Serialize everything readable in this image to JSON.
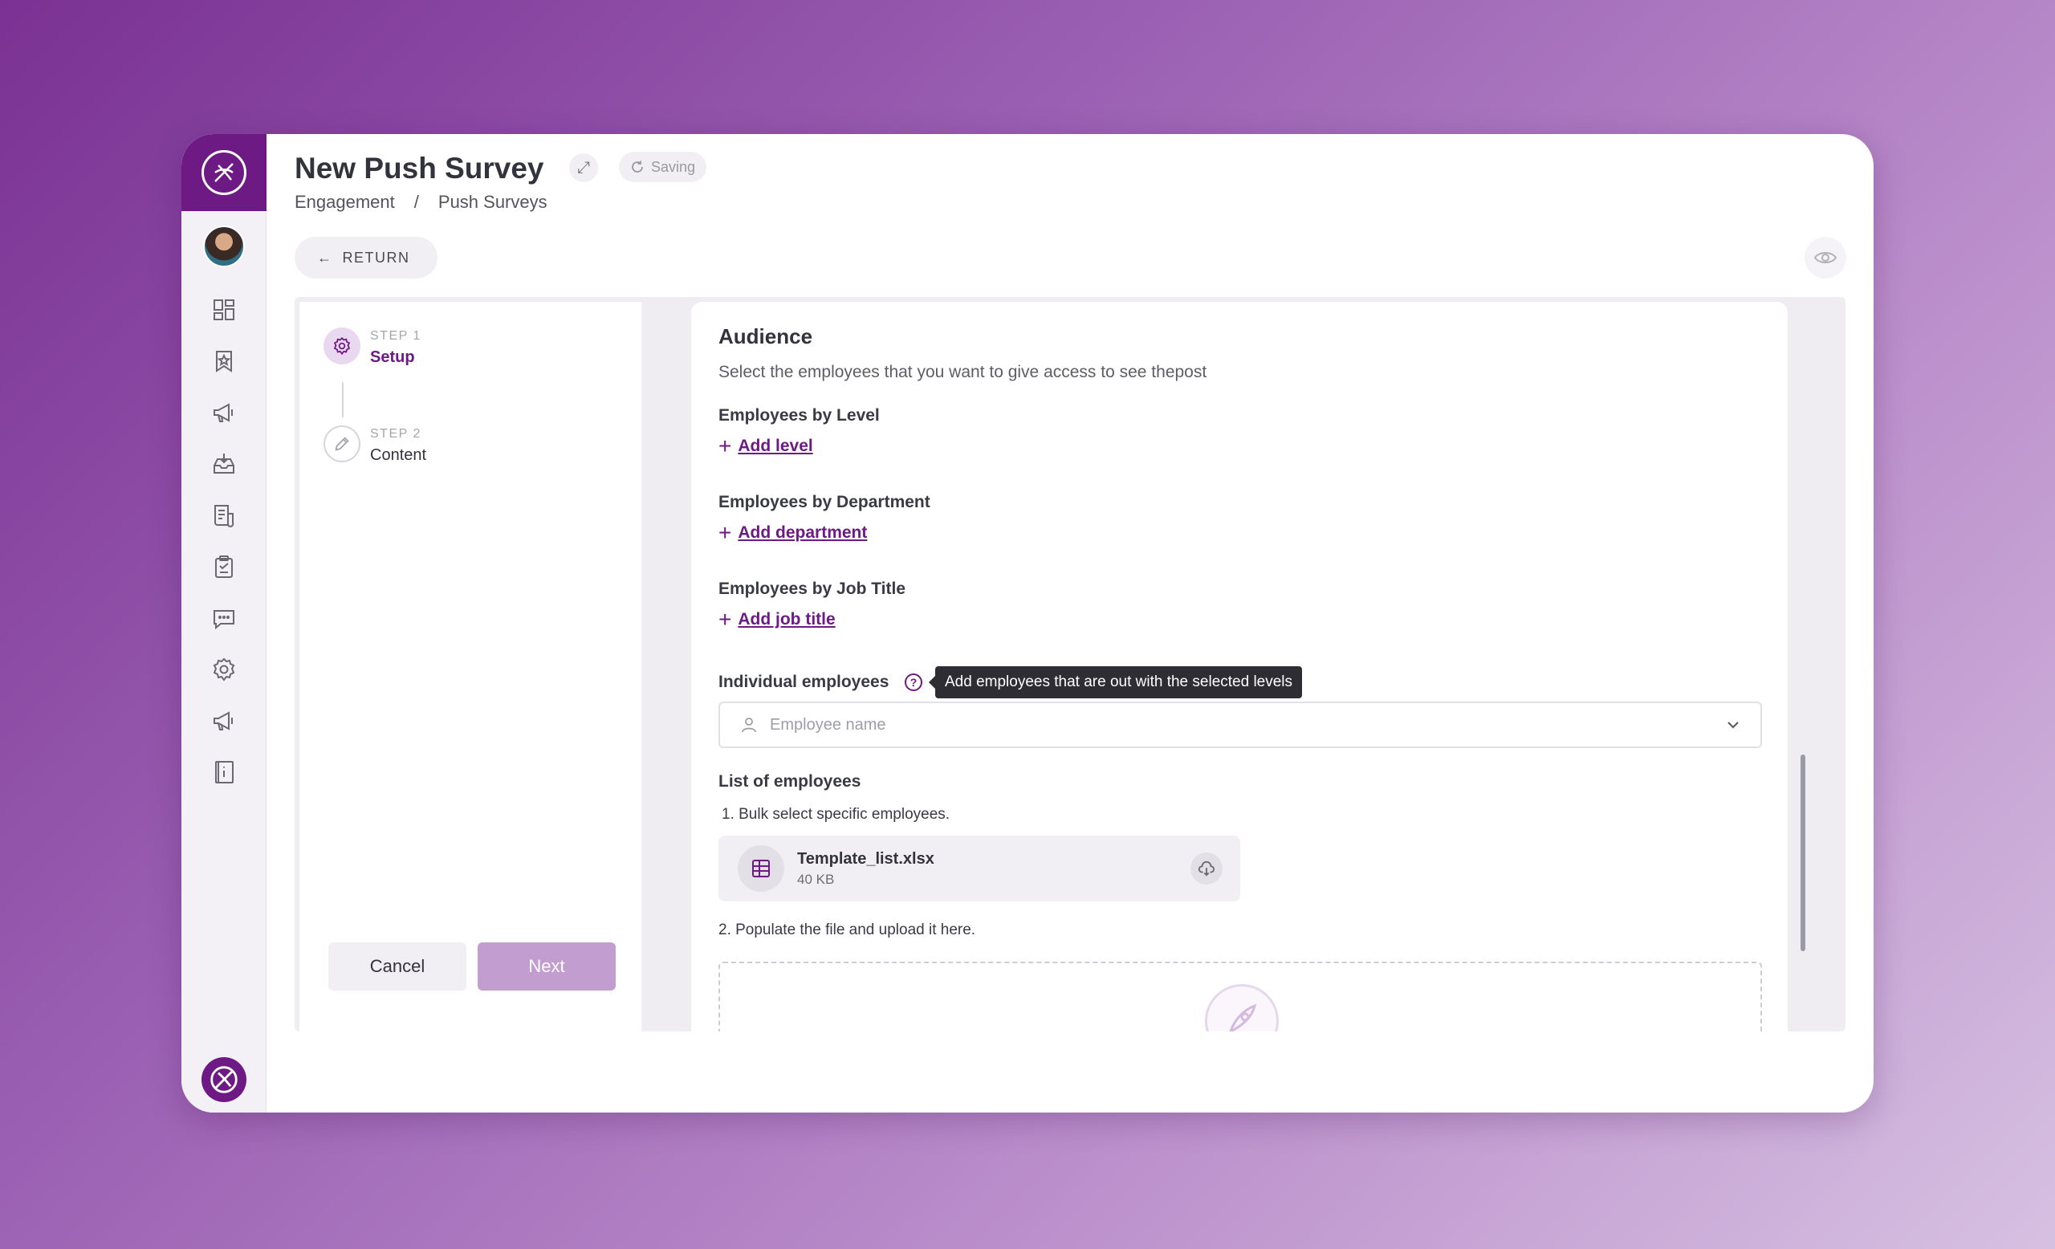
{
  "header": {
    "title": "New Push Survey",
    "status": "Saving",
    "breadcrumb": [
      "Engagement",
      "/",
      "Push Surveys"
    ],
    "return_label": "RETURN"
  },
  "nav": {
    "icons": [
      "dashboard-icon",
      "bookmark-star-icon",
      "megaphone-icon",
      "inbox-download-icon",
      "newsletter-icon",
      "clipboard-check-icon",
      "chat-icon",
      "settings-icon",
      "announcement-icon",
      "info-book-icon"
    ]
  },
  "steps": [
    {
      "number": "STEP 1",
      "label": "Setup",
      "state": "active"
    },
    {
      "number": "STEP 2",
      "label": "Content",
      "state": "inactive"
    }
  ],
  "actions": {
    "cancel": "Cancel",
    "next": "Next"
  },
  "audience": {
    "title": "Audience",
    "subtitle": "Select the employees that you want to give access to see thepost",
    "by_level": {
      "label": "Employees by Level",
      "add": "Add level"
    },
    "by_department": {
      "label": "Employees by Department",
      "add": "Add department"
    },
    "by_job_title": {
      "label": "Employees by Job Title",
      "add": "Add job title"
    },
    "individual": {
      "label": "Individual employees",
      "help": "?",
      "tooltip": "Add employees that are out with the selected levels",
      "placeholder": "Employee name"
    },
    "list": {
      "label": "List of employees",
      "step1": "1. Bulk select specific employees.",
      "step2": "2.  Populate the file and upload it here.",
      "file": {
        "name": "Template_list.xlsx",
        "size": "40 KB"
      }
    }
  },
  "colors": {
    "brand": "#6e1a85",
    "next_disabled": "#c29dcf"
  }
}
